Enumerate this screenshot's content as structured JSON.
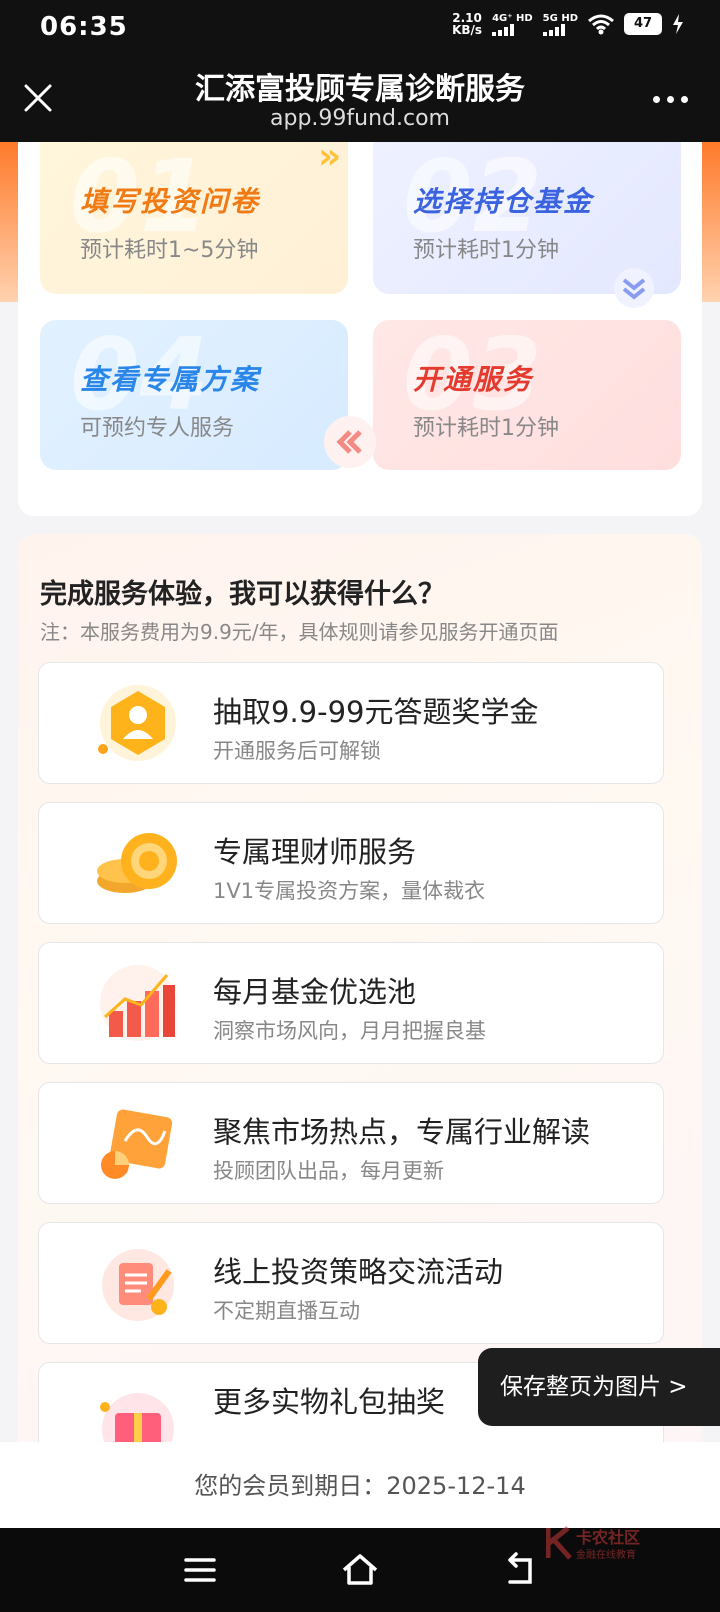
{
  "status": {
    "time": "06:35",
    "speed": "2.10",
    "speed_unit": "KB/s",
    "sim1": "4G⁺ HD",
    "sim2": "5G HD",
    "battery": "47"
  },
  "header": {
    "title": "汇添富投顾专属诊断服务",
    "url": "app.99fund.com"
  },
  "steps": [
    {
      "num": "01",
      "title": "填写投资问卷",
      "desc": "预计耗时1~5分钟"
    },
    {
      "num": "02",
      "title": "选择持仓基金",
      "desc": "预计耗时1分钟"
    },
    {
      "num": "04",
      "title": "查看专属方案",
      "desc": "可预约专人服务"
    },
    {
      "num": "03",
      "title": "开通服务",
      "desc": "预计耗时1分钟"
    }
  ],
  "benefits": {
    "title": "完成服务体验，我可以获得什么？",
    "note": "注：本服务费用为9.9元/年，具体规则请参见服务开通页面",
    "items": [
      {
        "title": "抽取9.9-99元答题奖学金",
        "sub": "开通服务后可解锁",
        "icon": "gift-badge-icon"
      },
      {
        "title": "专属理财师服务",
        "sub": "1V1专属投资方案，量体裁衣",
        "icon": "coins-icon"
      },
      {
        "title": "每月基金优选池",
        "sub": "洞察市场风向，月月把握良基",
        "icon": "bar-chart-icon"
      },
      {
        "title": "聚焦市场热点，专属行业解读",
        "sub": "投顾团队出品，每月更新",
        "icon": "report-icon"
      },
      {
        "title": "线上投资策略交流活动",
        "sub": "不定期直播互动",
        "icon": "strategy-doc-icon"
      },
      {
        "title": "更多实物礼包抽奖",
        "sub": "",
        "icon": "gift-box-icon"
      }
    ]
  },
  "save_button": "保存整页为图片 >",
  "footer": {
    "expiry": "您的会员到期日：2025-12-14"
  },
  "watermark": {
    "title": "卡农社区",
    "sub": "金融在线教育"
  },
  "colors": {
    "orange": "#f07a13",
    "blue": "#3b63e0",
    "sky": "#2a86e8",
    "red": "#e53a2e"
  }
}
